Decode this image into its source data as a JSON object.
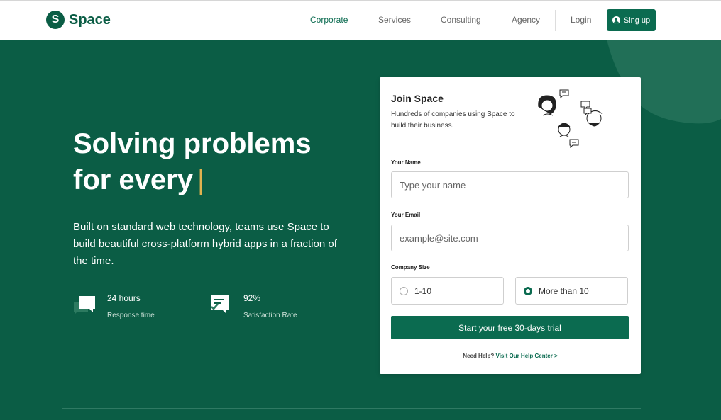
{
  "nav": {
    "logo_letter": "S",
    "logo_text": "Space",
    "links": [
      "Corporate",
      "Services",
      "Consulting",
      "Agency"
    ],
    "active_link": "Corporate",
    "login": "Login",
    "signup": "Sing up"
  },
  "hero": {
    "title_line1": "Solving problems",
    "title_line2": "for every",
    "cursor": "|",
    "description": "Built on standard web technology, teams use Space to build beautiful cross-platform hybrid apps in a fraction of the time.",
    "stats": [
      {
        "value": "24 hours",
        "label": "Response time",
        "icon": "chat-bubbles-icon"
      },
      {
        "value": "92%",
        "label": "Satisfaction Rate",
        "icon": "chat-check-icon"
      }
    ]
  },
  "form": {
    "title": "Join Space",
    "subtitle": "Hundreds of companies using Space to build their business.",
    "name_label": "Your Name",
    "name_placeholder": "Type your name",
    "email_label": "Your Email",
    "email_placeholder": "example@site.com",
    "company_label": "Company Size",
    "options": [
      "1-10",
      "More than 10"
    ],
    "selected_option": "More than 10",
    "cta": "Start your free 30-days trial",
    "help_question": "Need Help?",
    "help_link": "Visit Our Help Center >"
  },
  "colors": {
    "brand": "#0b5d45",
    "button": "#0b6b50",
    "cursor_accent": "#e0b24f"
  }
}
